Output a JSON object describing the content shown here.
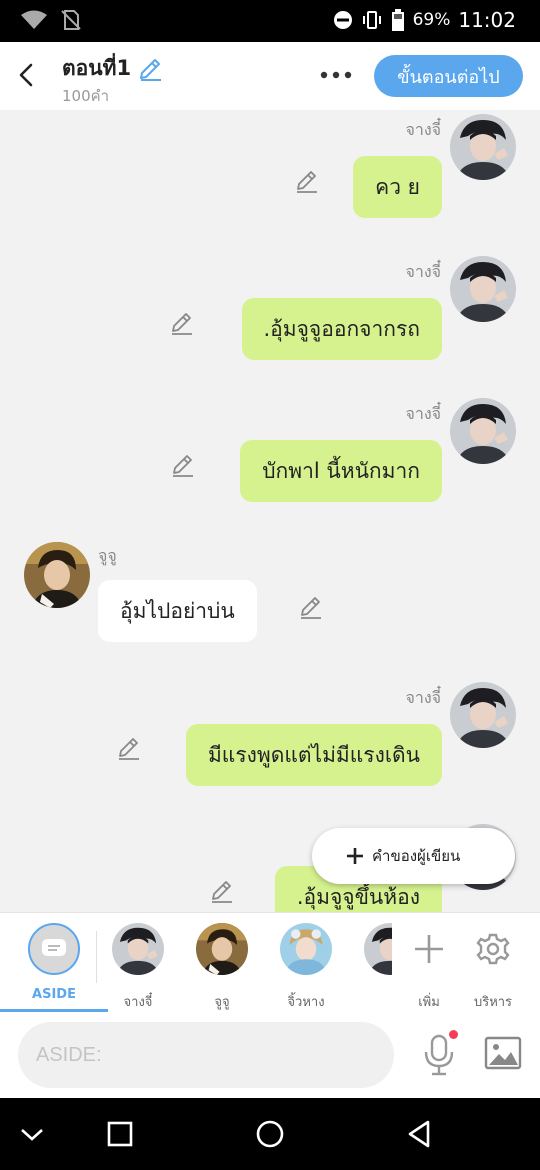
{
  "status_bar": {
    "battery": "69%",
    "time": "11:02",
    "icons": [
      "wifi-icon",
      "no-sim-icon",
      "do-not-disturb-icon",
      "vibrate-icon",
      "battery-icon"
    ]
  },
  "header": {
    "title": "ตอนที่1",
    "word_count": "100คำ",
    "next_button": "ขั้นตอนต่อไป"
  },
  "messages": [
    {
      "side": "right",
      "name": "จางจี๋",
      "text": "คว ย",
      "avatar": "janji"
    },
    {
      "side": "right",
      "name": "จางจี๋",
      "text": ".อุ้มจูจูออกจากรถ",
      "avatar": "janji"
    },
    {
      "side": "right",
      "name": "จางจี๋",
      "text": "บักพาl นี้หนักมาก",
      "avatar": "janji"
    },
    {
      "side": "left",
      "name": "จูจู",
      "text": "อุ้มไปอย่าบ่น",
      "avatar": "juju"
    },
    {
      "side": "right",
      "name": "จางจี๋",
      "text": "มีแรงพูดแต่ไม่มีแรงเดิน",
      "avatar": "janji"
    },
    {
      "side": "right",
      "name": "",
      "text": ".อุ้มจูจูขึ้นห้อง",
      "avatar": "janji"
    }
  ],
  "floating_button": {
    "label": "คำของผู้เขียน"
  },
  "character_bar": {
    "aside_label": "ASIDE",
    "characters": [
      {
        "name": "จางจี๋",
        "avatar": "janji"
      },
      {
        "name": "จูจู",
        "avatar": "juju"
      },
      {
        "name": "จิ้วหาง",
        "avatar": "jiuhang"
      }
    ],
    "add_label": "เพิ่ม",
    "manage_label": "บริหาร"
  },
  "input": {
    "placeholder": "ASIDE:"
  },
  "colors": {
    "accent": "#5aa7ee",
    "bubble_right": "#d6f28f",
    "bubble_left": "#ffffff",
    "chat_background": "#f2f2f2"
  }
}
